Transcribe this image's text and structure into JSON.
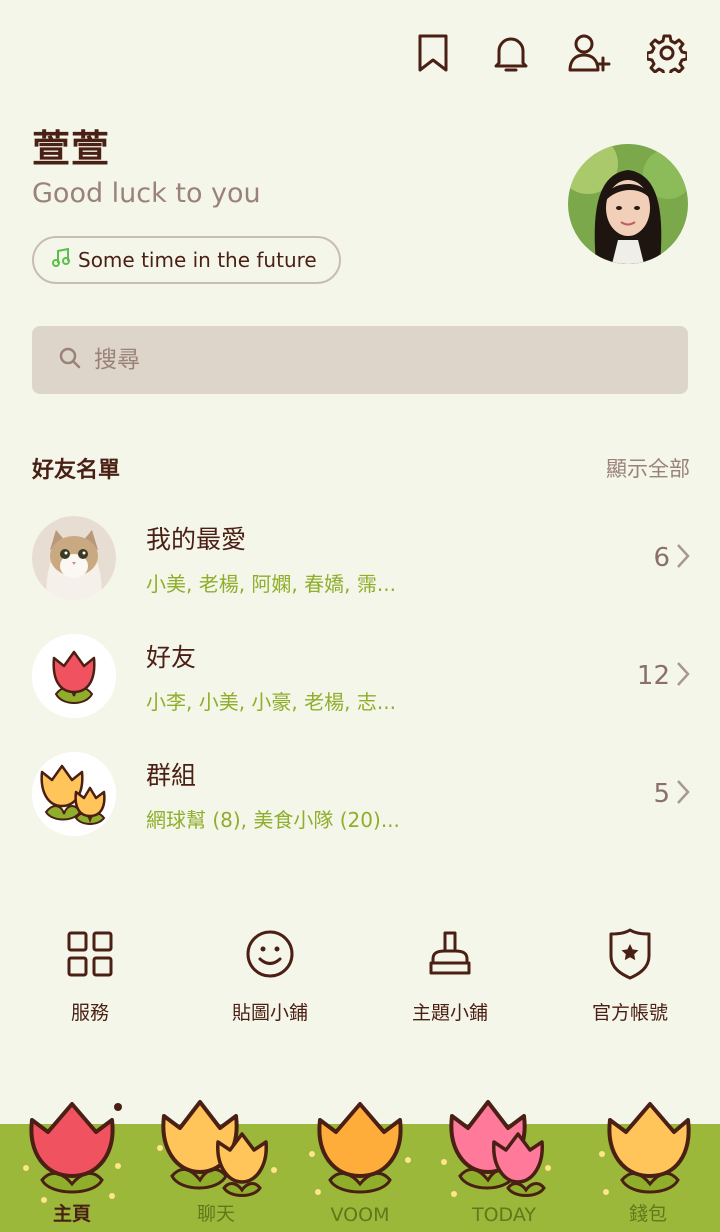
{
  "topbar": {
    "icons": [
      "bookmark-icon",
      "bell-icon",
      "add-friend-icon",
      "gear-icon"
    ]
  },
  "profile": {
    "name": "萱萱",
    "status": "Good luck to you",
    "music": "Some time in the future"
  },
  "search": {
    "placeholder": "搜尋"
  },
  "friends_section": {
    "title": "好友名單",
    "show_all": "顯示全部"
  },
  "groups": [
    {
      "title": "我的最愛",
      "members": "小美, 老楊, 阿嫻, 春嬌, 霈...",
      "count": "6"
    },
    {
      "title": "好友",
      "members": "小李, 小美, 小豪, 老楊, 志...",
      "count": "12"
    },
    {
      "title": "群組",
      "members": "網球幫 (8), 美食小隊 (20)...",
      "count": "5"
    }
  ],
  "quick_actions": [
    {
      "label": "服務",
      "icon": "grid-icon"
    },
    {
      "label": "貼圖小鋪",
      "icon": "smiley-icon"
    },
    {
      "label": "主題小鋪",
      "icon": "brush-icon"
    },
    {
      "label": "官方帳號",
      "icon": "shield-star-icon"
    }
  ],
  "tabs": [
    {
      "label": "主頁",
      "active": true
    },
    {
      "label": "聊天",
      "active": false
    },
    {
      "label": "VOOM",
      "active": false
    },
    {
      "label": "TODAY",
      "active": false
    },
    {
      "label": "錢包",
      "active": false
    }
  ],
  "colors": {
    "background": "#f5f6ea",
    "text_dark": "#4a1f14",
    "text_muted": "#9a8278",
    "accent_green": "#8fae2c",
    "bottom_grass": "#9bb83a",
    "search_bg": "#ddd5ca"
  }
}
